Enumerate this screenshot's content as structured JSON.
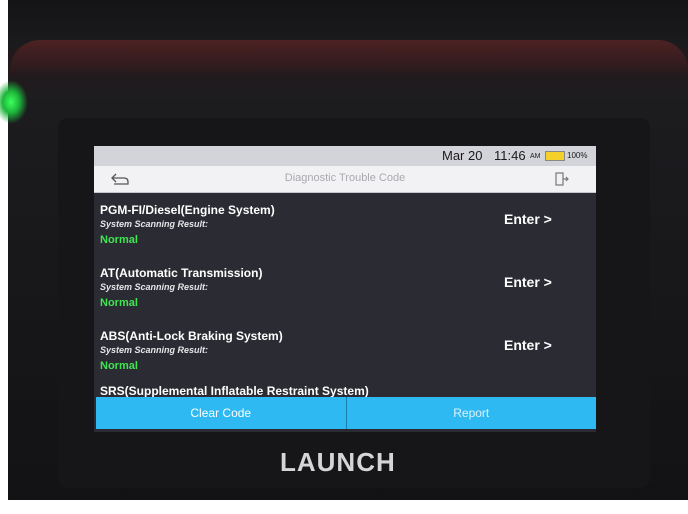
{
  "status_bar": {
    "date": "Mar 20",
    "time": "11:46",
    "ampm": "AM",
    "battery": "100%"
  },
  "header": {
    "title": "Diagnostic Trouble Code",
    "back_icon": "back-arrow-icon",
    "exit_icon": "exit-icon"
  },
  "systems": [
    {
      "name": "PGM-FI/Diesel(Engine System)",
      "result_label": "System Scanning Result:",
      "result": "Normal",
      "action": "Enter >"
    },
    {
      "name": "AT(Automatic Transmission)",
      "result_label": "System Scanning Result:",
      "result": "Normal",
      "action": "Enter >"
    },
    {
      "name": "ABS(Anti-Lock Braking System)",
      "result_label": "System Scanning Result:",
      "result": "Normal",
      "action": "Enter >"
    },
    {
      "name": "SRS(Supplemental Inflatable Restraint System)"
    }
  ],
  "footer": {
    "clear_code": "Clear Code",
    "report": "Report"
  },
  "brand": "LAUNCH",
  "colors": {
    "accent": "#2fb9f2",
    "status_normal": "#3ee650",
    "screen_bg": "#2b2c33"
  }
}
